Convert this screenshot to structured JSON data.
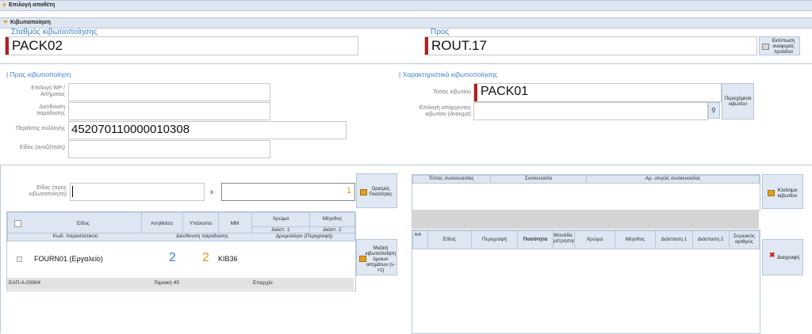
{
  "header_top": {
    "label": "Επιλογή αποθέτη"
  },
  "header_boxing": {
    "label": "Κιβωτιοποίηση"
  },
  "station": {
    "title": "Σταθμός κιβωτιοποίησης",
    "value": "PACK02"
  },
  "to": {
    "title": "Προς",
    "value": "ROUT.17"
  },
  "print_button": {
    "label": "Εκτύπωση αναφοράς προόδου"
  },
  "for_boxing": {
    "title": "Προς κιβωτιοποίηση",
    "wp_label": "Επιλογή WP / Αιτήματος",
    "address_label": "Διεύθυνση παράδοσης",
    "collector_label": "Περιέκτης συλλογής",
    "collector_value": "452070110000010308",
    "item_search_label": "Είδος (αναζήτηση)"
  },
  "box_features": {
    "title": "Χαρακτηριστικά κιβωτιοποίησης",
    "box_type_label": "Τύπος κιβωτίου",
    "box_type_value": "PACK01",
    "existing_box_label": "Επιλογή υπάρχοντος κιβωτίου (άνοιγμα)",
    "contents_button": "Περιεχόμενα κιβωτίου"
  },
  "item_entry": {
    "label": "Είδος (προς κιβωτιοποίηση)",
    "times": "x",
    "qty_value": "1",
    "set_qty_button": "Ορισμός Ποσότητας",
    "bulk_button": "Μαζική κιβωτιοποίηση όμοιων αιτημάτων (ν->1)"
  },
  "left_grid": {
    "headers": [
      "Είδος",
      "Αιτηθείσα",
      "Υπόλοιπο",
      "ΜΜ",
      "Χρώμα",
      "Μέγεθος",
      "Διάστ. 1",
      "Διάστ. 2"
    ],
    "subheaders": [
      "Κωδ. παραστατικού",
      "Διεύθυνση παράδοσης",
      "Δρομολόγιο (Περιγραφή)"
    ],
    "row": {
      "item": "FOURN01 (Εργαλείο)",
      "requested": "2",
      "remaining": "2",
      "unit": "ΚΙΒ36"
    },
    "subrow": {
      "doc": "ΕΑΠ-Α-00904",
      "address": "Ταμιακή 45",
      "route": "Επαρχία"
    }
  },
  "right_top_grid": {
    "headers": [
      "Τύπος συσκευασίας",
      "Συσκευασία",
      "Αρ. σειράς συσκευασίας"
    ],
    "close_button": "Κλείσιμο κιβωτίου"
  },
  "right_grid": {
    "headers": [
      "Α/Α",
      "Είδος",
      "Περιγραφή",
      "Ποσότητα",
      "Μονάδα μέτρησης",
      "Χρώμα",
      "Μέγεθος",
      "Διάσταση 1",
      "Διάσταση 2",
      "Σειριακός αριθμός"
    ],
    "delete_button": "Διαγραφή"
  }
}
